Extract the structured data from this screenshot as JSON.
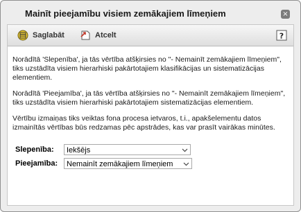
{
  "dialog": {
    "title": "Mainīt pieejamību visiem zemākajiem līmeņiem",
    "close_label": "×"
  },
  "toolbar": {
    "save_label": "Saglabāt",
    "cancel_label": "Atcelt",
    "help_label": "?"
  },
  "content": {
    "paragraph1": "Norādītā 'Slepenība', ja tās vērtība atšķirsies no \"- Nemainīt zemākajiem līmeņiem\", tiks uzstādīta visiem hierarhiski pakārtotajiem klasifikācijas un sistematizācijas elementiem.",
    "paragraph2": "Norādītā 'Pieejamība', ja tās vērtība atšķirsies no \"- Nemainīt zemākajiem līmeņiem\", tiks uzstādīta visiem hierarhiski pakārtotajiem sistematizācijas elementiem.",
    "paragraph3": "Vērtību izmaiņas tiks veiktas fona procesa ietvaros, t.i., apakšelementu datos izmainītās vērtības būs redzamas pēc apstrādes, kas var prasīt vairākas minūtes."
  },
  "form": {
    "secrecy_label": "Slepenība:",
    "secrecy_value": "Iekšējs",
    "availability_label": "Pieejamība:",
    "availability_value": "Nemainīt zemākajiem līmeņiem"
  }
}
